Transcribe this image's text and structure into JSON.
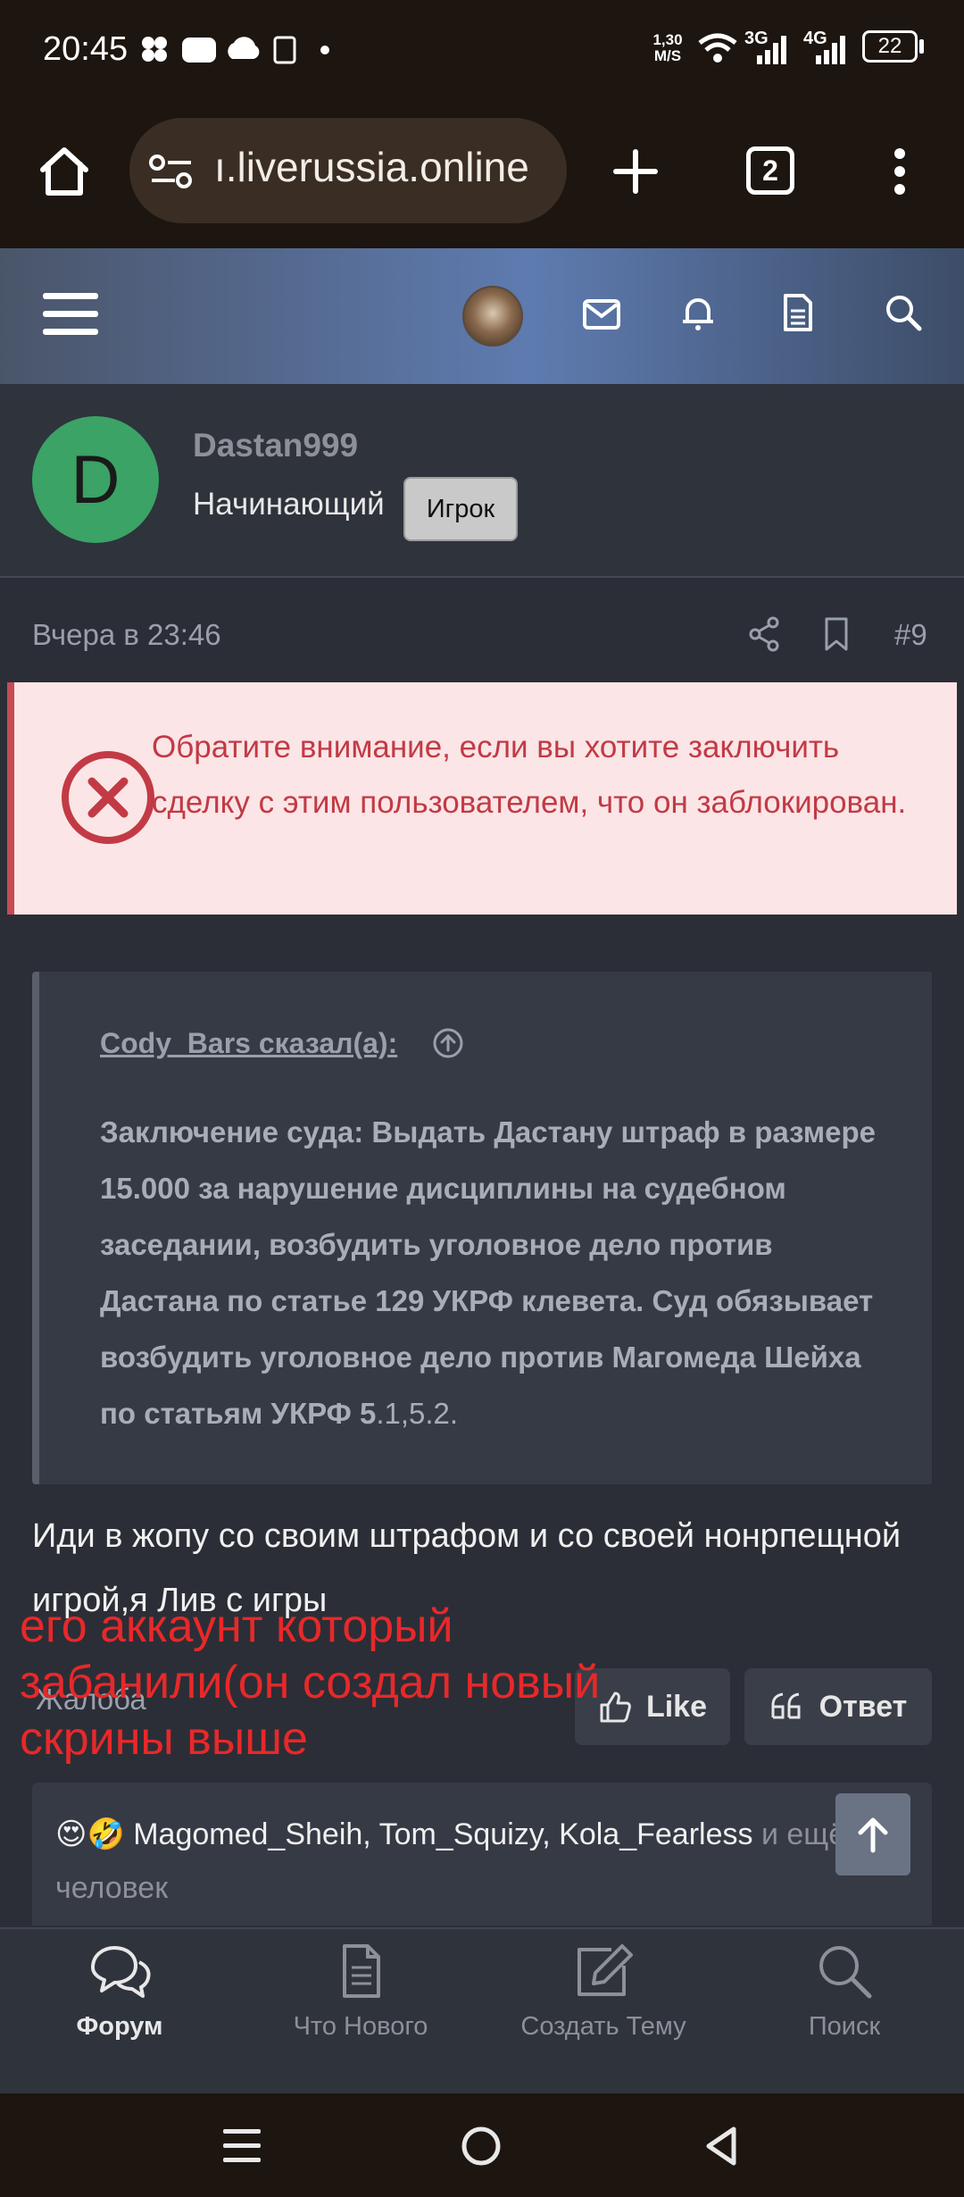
{
  "status_bar": {
    "time": "20:45",
    "net_speed_top": "1,30",
    "net_speed_bottom": "M/S",
    "sim1": "3G",
    "sim2": "4G",
    "battery": "22"
  },
  "browser": {
    "url": "ı.liverussia.online",
    "tab_count": "2"
  },
  "profile": {
    "avatar_letter": "D",
    "username": "Dastan999",
    "user_title": "Начинающий",
    "badge": "Игрок"
  },
  "post": {
    "time": "Вчера в 23:46",
    "number": "#9",
    "warning": "Обратите внимание, если вы хотите заключить сделку с этим пользователем, что он заблокирован.",
    "quote_author": "Cody_Bars сказал(а):",
    "quote_text_bold": "Заключение суда: Выдать Дастану штраф в размере 15.000 за нарушение дисциплины на судебном заседании, возбудить уголовное дело против Дастана по статье 129 УКРФ клевета. Суд обязывает возбудить уголовное дело против Магомеда Шейха по статьям УКРФ 5",
    "quote_text_tail": ".1,5.2.",
    "message": "Иди в жопу со своим штрафом и со своей нонрпещной игрой,я Лив с игры",
    "report_label": "Жалоба",
    "like_label": "Like",
    "reply_label": "Ответ",
    "overlay_note": "его аккаунт который забанили(он создал новый скрины выше",
    "reactions": {
      "emojis": "😍🤣",
      "user1": "Magomed_Sheih",
      "sep1": ", ",
      "user2": "Tom_Squizy",
      "sep2": ", ",
      "user3": "Kola_Fearless",
      "tail": " и ещё 1 человек"
    }
  },
  "bottom_nav": [
    {
      "label": "Форум",
      "icon": "forum-chat-icon",
      "active": true
    },
    {
      "label": "Что Нового",
      "icon": "document-icon",
      "active": false
    },
    {
      "label": "Создать Тему",
      "icon": "edit-icon",
      "active": false
    },
    {
      "label": "Поиск",
      "icon": "search-icon",
      "active": false
    }
  ],
  "colors": {
    "warning_bg": "#fbe5e6",
    "warning_text": "#c23a45",
    "overlay_red": "#e8282a",
    "avatar_green": "#3aa365"
  }
}
